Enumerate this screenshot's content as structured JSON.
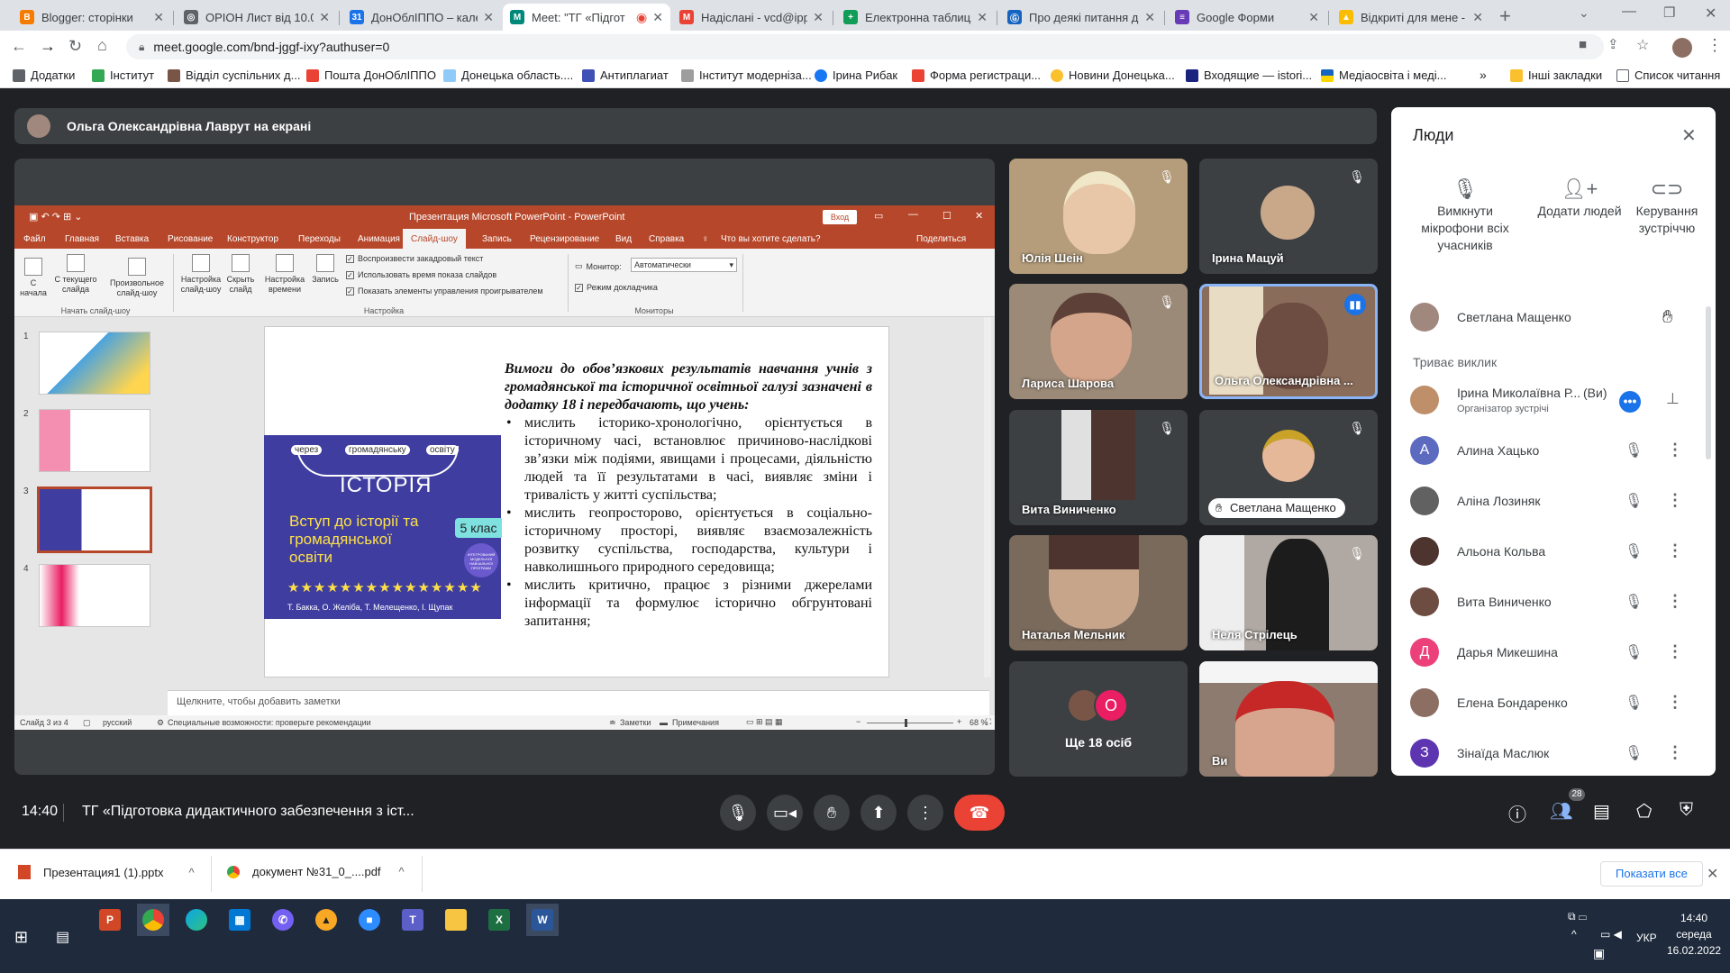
{
  "browser": {
    "tabs": [
      {
        "title": "Blogger: сторінки",
        "color": "#f57c00",
        "letter": "B"
      },
      {
        "title": "ОРІОН Лист від 10.02",
        "color": "#5f6368",
        "letter": "◎"
      },
      {
        "title": "ДонОблІППО – кален",
        "color": "#1a73e8",
        "letter": "31"
      },
      {
        "title": "Meet: \"ТГ «Підгот",
        "color": "#00897b",
        "letter": "M"
      },
      {
        "title": "Надіслані - vcd@ippo",
        "color": "#ea4335",
        "letter": "M"
      },
      {
        "title": "Електронна таблиця",
        "color": "#0f9d58",
        "letter": "+"
      },
      {
        "title": "Про деякі питання до",
        "color": "#1565c0",
        "letter": "Ⓖ"
      },
      {
        "title": "Google Форми",
        "color": "#673ab7",
        "letter": "≡"
      },
      {
        "title": "Відкриті для мене - G",
        "color": "#fbbc04",
        "letter": "▲"
      }
    ],
    "url": "meet.google.com/bnd-jggf-ixy?authuser=0",
    "bookmarks": [
      {
        "label": "Додатки",
        "color": "#5f6368"
      },
      {
        "label": "Інститут",
        "color": "#34a853"
      },
      {
        "label": "Відділ суспільних д...",
        "color": "#795548"
      },
      {
        "label": "Пошта ДонОблІППО",
        "color": "#ea4335"
      },
      {
        "label": "Донецька область....",
        "color": "#90caf9"
      },
      {
        "label": "Антиплагиат",
        "color": "#3f51b5"
      },
      {
        "label": "Інститут модернізa...",
        "color": "#9e9e9e"
      },
      {
        "label": "Ірина Рибак",
        "color": "#1877f2"
      },
      {
        "label": "Форма регистраци...",
        "color": "#ea4335"
      },
      {
        "label": "Новини Донецька...",
        "color": "#fbc02d"
      },
      {
        "label": "Входящие — istori...",
        "color": "#1a237e"
      },
      {
        "label": "Медіаосвіта і меді...",
        "color": "#ffd600"
      }
    ],
    "other_bookmarks": "Інші закладки",
    "reading_list": "Список читання"
  },
  "meet": {
    "presenter": "Ольга Олександрівна Лаврут на екрані",
    "time": "14:40",
    "meeting_title": "ТГ «Підготовка дидактичного забезпечення з іст...",
    "people_badge": "28",
    "tiles": [
      {
        "name": "Юлія Шеін"
      },
      {
        "name": "Ірина Мацуй"
      },
      {
        "name": "Лариса Шарова"
      },
      {
        "name": "Ольга Олександрівна ..."
      },
      {
        "name": "Вита Виниченко"
      },
      {
        "name": "Светлана Мащенко"
      },
      {
        "name": "Наталья Мельник"
      },
      {
        "name": "Неля Стрілець"
      },
      {
        "name": "Ще 18 осіб"
      },
      {
        "name": "Ви"
      }
    ],
    "more_avatar_letter": "О"
  },
  "people_panel": {
    "title": "Люди",
    "actions": [
      {
        "label": "Вимкнути мікрофони всіх учасників"
      },
      {
        "label": "Додати людей"
      },
      {
        "label": "Керування зустріччю"
      }
    ],
    "hand_raised": "Светлана Мащенко",
    "section": "Триває виклик",
    "host_name": "Ірина Миколаївна Р...",
    "host_you": "(Ви)",
    "host_role": "Організатор зустрічі",
    "participants": [
      {
        "name": "Алина Хацько",
        "letter": "А",
        "color": "#5c6bc0"
      },
      {
        "name": "Аліна Лозиняк",
        "letter": "",
        "color": "#616161"
      },
      {
        "name": "Альона Кольва",
        "letter": "",
        "color": "#4e342e"
      },
      {
        "name": "Вита Виниченко",
        "letter": "",
        "color": "#6d4c41"
      },
      {
        "name": "Дарья Микешина",
        "letter": "Д",
        "color": "#ec407a"
      },
      {
        "name": "Елена Бондаренко",
        "letter": "",
        "color": "#8d6e63"
      },
      {
        "name": "Зінаїда Маслюк",
        "letter": "З",
        "color": "#5e35b1"
      }
    ]
  },
  "ppt": {
    "window_title": "Презентация Microsoft PowerPoint - PowerPoint",
    "signin": "Вход",
    "menu": [
      "Файл",
      "Главная",
      "Вставка",
      "Рисование",
      "Конструктор",
      "Переходы",
      "Анимация",
      "Слайд-шоу",
      "Запись",
      "Рецензирование",
      "Вид",
      "Справка"
    ],
    "tell_me": "Что вы хотите сделать?",
    "share": "Поделиться",
    "ribbon": {
      "from_start": "С начала",
      "from_current": "С текущего слайда",
      "custom": "Произвольное слайд-шоу",
      "group1": "Начать слайд-шоу",
      "setup": "Настройка слайд-шоу",
      "hide": "Скрыть слайд",
      "timings": "Настройка времени",
      "record": "Запись",
      "cb_narration": "Воспроизвести закадровый текст",
      "cb_timings": "Использовать время показа слайдов",
      "cb_controls": "Показать элементы управления проигрывателем",
      "group2": "Настройка",
      "monitor_label": "Монитор:",
      "monitor_value": "Автоматически",
      "presenter_view": "Режим докладчика",
      "group3": "Мониторы"
    },
    "slide": {
      "heading": "Вимоги до обов’язкових результатів навчання учнів з громадянської та історичної освітньої галузі зазначені в додатку 18 і передбачають, що учень:",
      "bullets": [
        "мислить історико-хронологічно, орієнтується в історичному часі, встановлює причиново-наслідкові зв’язки між подіями, явищами і процесами, діяльністю людей та її результатами в часі, виявляє зміни і тривалість у житті суспільства;",
        "мислить геопросторово, орієнтується в соціально-історичному просторі, виявляє взаємозалежність розвитку суспільства, господарства, культури і навколишнього природного середовища;",
        "мислить критично, працює з різними джерелами інформації та формулює історично обгрунтовані запитання;"
      ],
      "cover": {
        "tag1": "через",
        "tag2": "громадянську",
        "tag3": "освіту",
        "title": "ІСТОРІЯ",
        "subtitle": "Вступ до історії та громадянської освіти",
        "grade": "5 клас",
        "stars": "★★★★★★★★★★★★★★★",
        "authors": "Т. Бакка, О. Желіба, Т. Мелещенко, І. Щупак",
        "badge": "ІНТЕГРОВАНИЙ МОДЕЛЬНОЇ НАВЧАЛЬНОЇ ПРОГРАМИ"
      }
    },
    "notes_placeholder": "Щелкните, чтобы добавить заметки",
    "status_slide": "Слайд 3 из 4",
    "status_lang": "русский",
    "status_access": "Специальные возможности: проверьте рекомендации",
    "status_notes": "Заметки",
    "status_comments": "Примечания",
    "zoom": "68 %",
    "thumb_numbers": [
      "1",
      "2",
      "3",
      "4"
    ]
  },
  "downloads": {
    "items": [
      "Презентация1 (1).pptx",
      "документ №31_0_....pdf"
    ],
    "show_all": "Показати все"
  },
  "taskbar": {
    "time": "14:40",
    "day": "середа",
    "date": "16.02.2022",
    "lang": "УКР"
  },
  "colors": {
    "meet_bg": "#202124",
    "ppt_accent": "#b7472a",
    "hangup": "#ea4335",
    "cover": "#3f3ea0"
  }
}
